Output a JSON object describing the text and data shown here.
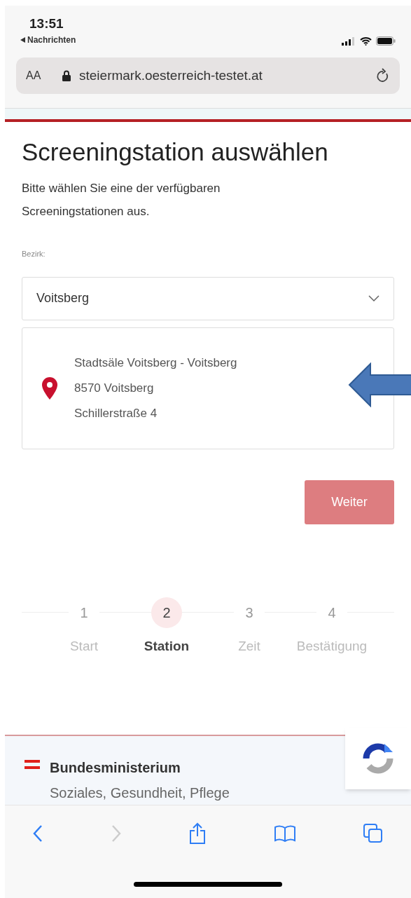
{
  "status_bar": {
    "time": "13:51",
    "back_label": "Nachrichten"
  },
  "browser": {
    "text_size": "AA",
    "url": "steiermark.oesterreich-testet.at"
  },
  "page": {
    "title": "Screeningstation auswählen",
    "description": "Bitte wählen Sie eine der verfügbaren Screeningstationen aus.",
    "district_label": "Bezirk:",
    "district_value": "Voitsberg",
    "station": {
      "name": "Stadtsäle Voitsberg - Voitsberg",
      "city": "8570 Voitsberg",
      "street": "Schillerstraße 4"
    },
    "next_button": "Weiter"
  },
  "steps": [
    {
      "number": "1",
      "label": "Start",
      "selected": false
    },
    {
      "number": "2",
      "label": "Station",
      "selected": true
    },
    {
      "number": "3",
      "label": "Zeit",
      "selected": false
    },
    {
      "number": "4",
      "label": "Bestätigung",
      "selected": false
    }
  ],
  "footer": {
    "ministry": "Bundesministerium",
    "department": "Soziales, Gesundheit, Pflege"
  }
}
